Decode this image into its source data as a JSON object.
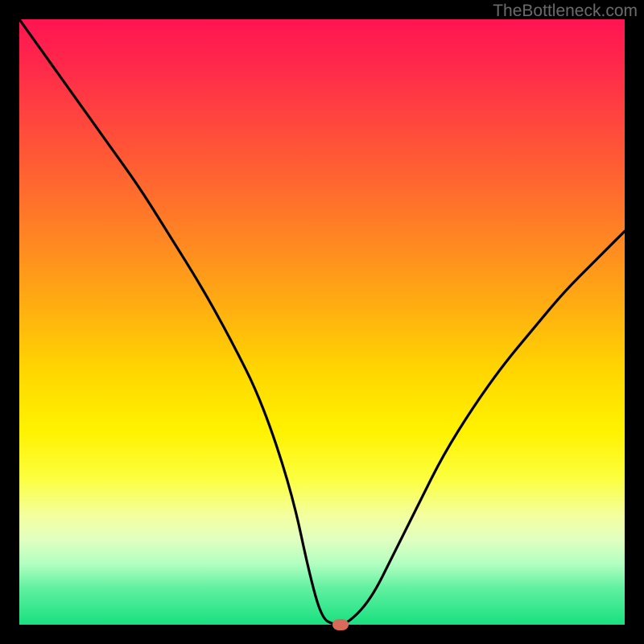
{
  "watermark": "TheBottleneck.com",
  "chart_data": {
    "type": "line",
    "title": "",
    "xlabel": "",
    "ylabel": "",
    "xlim": [
      0,
      100
    ],
    "ylim": [
      0,
      100
    ],
    "x": [
      0,
      5,
      10,
      15,
      20,
      25,
      30,
      35,
      40,
      45,
      48,
      50,
      52,
      54,
      58,
      62,
      66,
      70,
      75,
      80,
      85,
      90,
      95,
      100
    ],
    "values": [
      100,
      93,
      86,
      79,
      72,
      64,
      56,
      47,
      37,
      22,
      8,
      1,
      0,
      0,
      4,
      12,
      20,
      28,
      36,
      43,
      49,
      55,
      60,
      65
    ],
    "marker": {
      "x": 53,
      "y": 0
    },
    "gradient_stops": [
      {
        "position": 0,
        "color": "#ff1452"
      },
      {
        "position": 50,
        "color": "#ffd000"
      },
      {
        "position": 100,
        "color": "#18e080"
      }
    ]
  }
}
